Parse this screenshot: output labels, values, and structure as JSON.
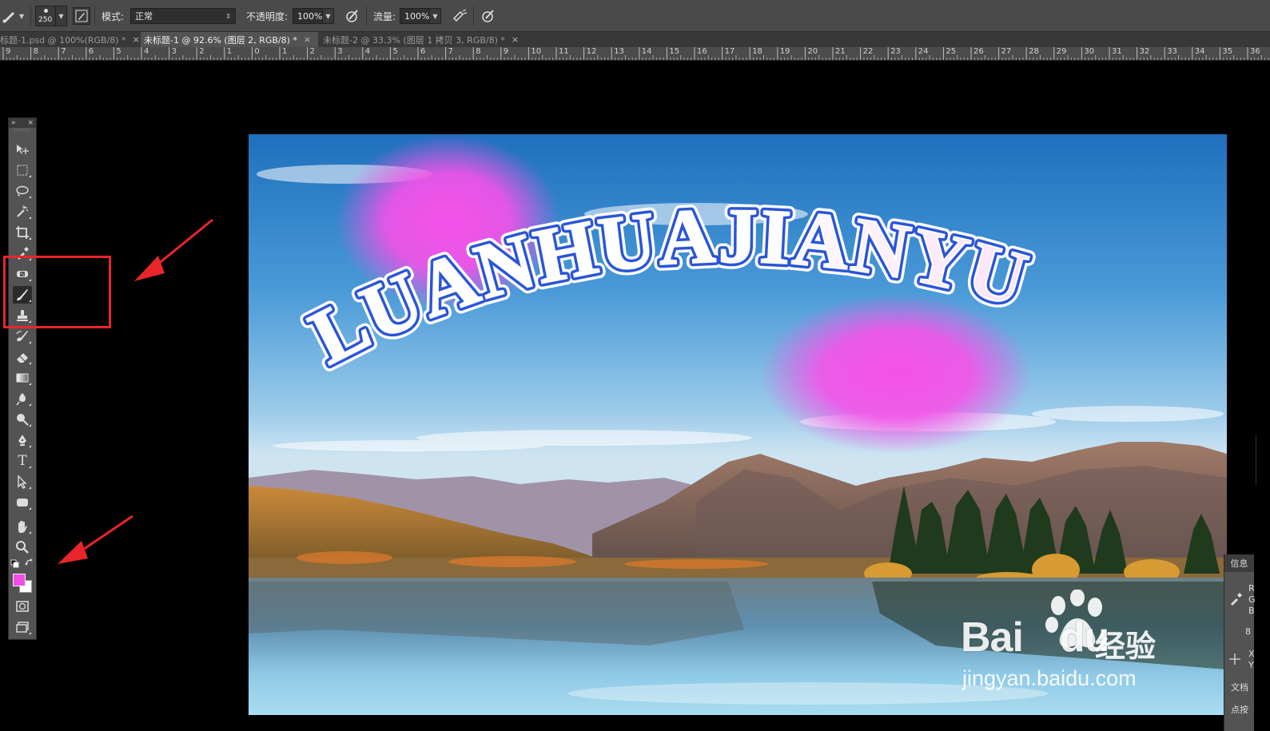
{
  "options_bar": {
    "brush_size": "250",
    "mode_label": "模式:",
    "mode_value": "正常",
    "opacity_label": "不透明度:",
    "opacity_value": "100%",
    "flow_label": "流量:",
    "flow_value": "100%"
  },
  "tabs": [
    {
      "label": "标题-1.psd @ 100%(RGB/8) *",
      "close": "×",
      "active": false
    },
    {
      "label": "未标题-1 @ 92.6% (图层 2, RGB/8) *",
      "close": "×",
      "active": true
    },
    {
      "label": "未标题-2 @ 33.3% (图层 1 拷贝 3, RGB/8) *",
      "close": "×",
      "active": false
    }
  ],
  "ruler": {
    "labels": [
      "9",
      "8",
      "7",
      "6",
      "5",
      "4",
      "3",
      "2",
      "1",
      "0",
      "1",
      "2",
      "3",
      "4",
      "5",
      "6",
      "7",
      "8",
      "9",
      "10",
      "11",
      "12",
      "13",
      "14",
      "15",
      "16",
      "17",
      "18",
      "19",
      "20",
      "21",
      "22",
      "23",
      "24",
      "25",
      "26",
      "27",
      "28",
      "29",
      "30",
      "31",
      "32",
      "33",
      "34",
      "35",
      "36"
    ]
  },
  "toolbox": {
    "header_expand": "»",
    "header_close": "×",
    "tools": [
      {
        "name": "move-tool",
        "icon": "move-icon"
      },
      {
        "name": "marquee-tool",
        "icon": "marquee-icon"
      },
      {
        "name": "lasso-tool",
        "icon": "lasso-icon"
      },
      {
        "name": "magic-wand-tool",
        "icon": "magic-wand-icon"
      },
      {
        "name": "crop-tool",
        "icon": "crop-icon"
      },
      {
        "name": "eyedropper-tool",
        "icon": "eyedropper-icon"
      },
      {
        "name": "healing-brush-tool",
        "icon": "bandage-icon"
      },
      {
        "name": "brush-tool",
        "icon": "brush-icon",
        "selected": true
      },
      {
        "name": "clone-stamp-tool",
        "icon": "stamp-icon"
      },
      {
        "name": "history-brush-tool",
        "icon": "history-brush-icon"
      },
      {
        "name": "eraser-tool",
        "icon": "eraser-icon"
      },
      {
        "name": "gradient-tool",
        "icon": "gradient-icon"
      },
      {
        "name": "blur-tool",
        "icon": "blur-icon"
      },
      {
        "name": "dodge-tool",
        "icon": "dodge-icon"
      },
      {
        "name": "pen-tool",
        "icon": "pen-icon"
      },
      {
        "name": "type-tool",
        "icon": "type-icon"
      },
      {
        "name": "path-selection-tool",
        "icon": "arrow-icon"
      },
      {
        "name": "shape-tool",
        "icon": "rounded-rect-icon"
      },
      {
        "name": "hand-tool",
        "icon": "hand-icon"
      },
      {
        "name": "zoom-tool",
        "icon": "zoom-icon"
      }
    ],
    "type_glyph": "T",
    "foreground_color": "#f04ee6",
    "background_color": "#ffffff"
  },
  "canvas": {
    "title_text": "LUANHUAJIANYU",
    "stroke_color": "#2a55d8",
    "glow_color": "#f552e8"
  },
  "info_panel": {
    "tab_label": "信息",
    "line_r": "R",
    "line_g": "G",
    "line_b": "B",
    "line_bits": "8",
    "line_x": "X",
    "line_y": "Y",
    "doc_label": "文档",
    "click_label": "点按"
  },
  "watermark": {
    "brand": "Bai",
    "brand_tail": "du",
    "cn": "经验",
    "url": "jingyan.baidu.com"
  },
  "colors": {
    "ui_panel": "#535353",
    "options_bar": "#4a4a4a",
    "highlight": "#e8262a"
  }
}
